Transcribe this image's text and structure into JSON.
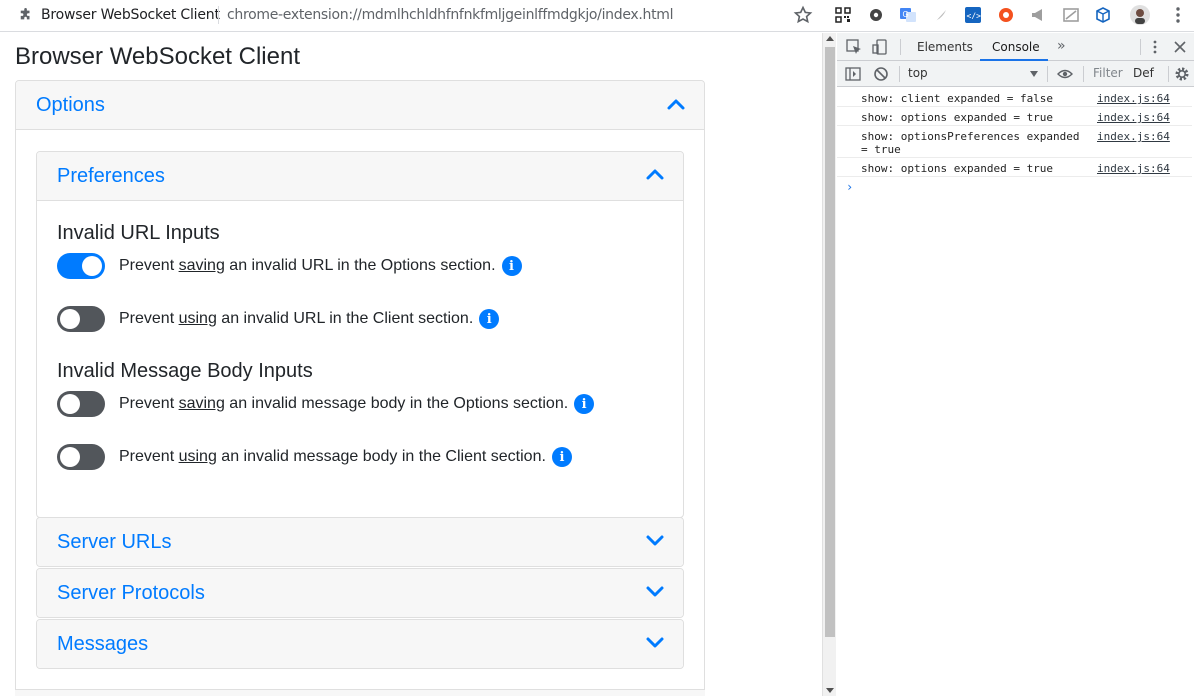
{
  "browser": {
    "tab_title": "Browser WebSocket Client",
    "url": "chrome-extension://mdmlhchldhfnfnkfmljgeinlffmdgkjo/index.html",
    "extension_icons": [
      "qr-code-icon",
      "gear-badge-icon",
      "translate-icon",
      "feather-icon",
      "code-icon",
      "orange-ring-icon",
      "megaphone-icon",
      "cast-icon",
      "box-icon",
      "avatar-icon"
    ]
  },
  "app": {
    "title": "Browser WebSocket Client",
    "options": {
      "label": "Options",
      "preferences": {
        "label": "Preferences",
        "url_section_title": "Invalid URL Inputs",
        "url_options": [
          {
            "pre": "Prevent ",
            "verb": "saving",
            "post": " an invalid URL in the Options section.",
            "enabled": true
          },
          {
            "pre": "Prevent ",
            "verb": "using",
            "post": " an invalid URL in the Client section.",
            "enabled": false
          }
        ],
        "body_section_title": "Invalid Message Body Inputs",
        "body_options": [
          {
            "pre": "Prevent ",
            "verb": "saving",
            "post": " an invalid message body in the Options section.",
            "enabled": false
          },
          {
            "pre": "Prevent ",
            "verb": "using",
            "post": " an invalid message body in the Client section.",
            "enabled": false
          }
        ]
      },
      "server_urls_label": "Server URLs",
      "server_protocols_label": "Server Protocols",
      "messages_label": "Messages"
    }
  },
  "devtools": {
    "tabs": [
      "Elements",
      "Console"
    ],
    "active_tab": "Console",
    "context": "top",
    "filter_placeholder": "Filter",
    "levels": "Def",
    "logs": [
      {
        "message": "show: client expanded = false",
        "source": "index.js:64"
      },
      {
        "message": "show: options expanded = true",
        "source": "index.js:64"
      },
      {
        "message": "show: optionsPreferences expanded = true",
        "source": "index.js:64"
      },
      {
        "message": "show: options expanded = true",
        "source": "index.js:64"
      }
    ],
    "prompt": "›"
  },
  "colors": {
    "accent": "#007bff",
    "toggle_off": "#52565b",
    "devtools_active": "#1a73e8"
  }
}
